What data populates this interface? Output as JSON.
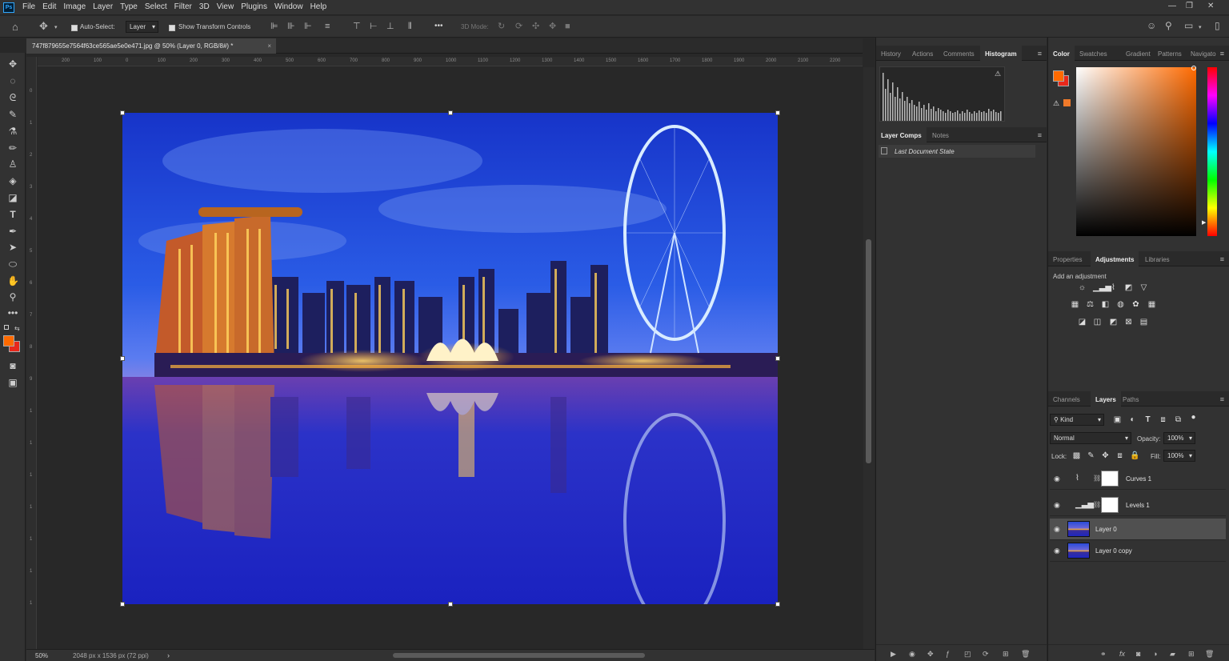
{
  "app": {
    "logo": "Ps"
  },
  "menu": [
    "File",
    "Edit",
    "Image",
    "Layer",
    "Type",
    "Select",
    "Filter",
    "3D",
    "View",
    "Plugins",
    "Window",
    "Help"
  ],
  "options": {
    "auto_select_label": "Auto-Select:",
    "auto_select_value": "Layer",
    "transform_label": "Show Transform Controls",
    "mode_3d": "3D Mode:",
    "more": "•••"
  },
  "document": {
    "tab_title": "747f879655e7564f63ce565ae5e0e471.jpg @ 50% (Layer 0, RGB/8#) *",
    "zoom": "50%",
    "dimensions": "2048 px x 1536 px (72 ppi)"
  },
  "ruler_h": [
    "200",
    "100",
    "0",
    "100",
    "200",
    "300",
    "400",
    "500",
    "600",
    "700",
    "800",
    "900",
    "1000",
    "1100",
    "1200",
    "1300",
    "1400",
    "1500",
    "1600",
    "1700",
    "1800",
    "1900",
    "2000",
    "2100",
    "2200"
  ],
  "ruler_v": [
    "0",
    "1",
    "2",
    "3",
    "4",
    "5",
    "6",
    "7",
    "8",
    "9",
    "1",
    "1",
    "1",
    "1",
    "1",
    "1",
    "1"
  ],
  "panel_mid": {
    "tabs": [
      "History",
      "Actions",
      "Comments",
      "Histogram"
    ],
    "tabs2": [
      "Layer Comps",
      "Notes"
    ],
    "layer_comp": "Last Document State"
  },
  "panel_color": {
    "tabs": [
      "Color",
      "Swatches",
      "Gradient",
      "Patterns",
      "Navigato"
    ],
    "fg_color": "#ff6a00",
    "bg_color": "#e8281b"
  },
  "panel_adjust": {
    "tabs": [
      "Properties",
      "Adjustments",
      "Libraries"
    ],
    "heading": "Add an adjustment"
  },
  "panel_layers": {
    "tabs": [
      "Channels",
      "Layers",
      "Paths"
    ],
    "filter": "Kind",
    "blend": "Normal",
    "opacity_label": "Opacity:",
    "opacity": "100%",
    "lock_label": "Lock:",
    "fill_label": "Fill:",
    "fill": "100%",
    "layers": [
      {
        "name": "Curves 1",
        "type": "adjustment",
        "icon": "curves-icon",
        "selected": false
      },
      {
        "name": "Levels 1",
        "type": "adjustment",
        "icon": "levels-icon",
        "selected": false
      },
      {
        "name": "Layer 0",
        "type": "image",
        "selected": true
      },
      {
        "name": "Layer 0 copy",
        "type": "image",
        "selected": false
      }
    ]
  }
}
